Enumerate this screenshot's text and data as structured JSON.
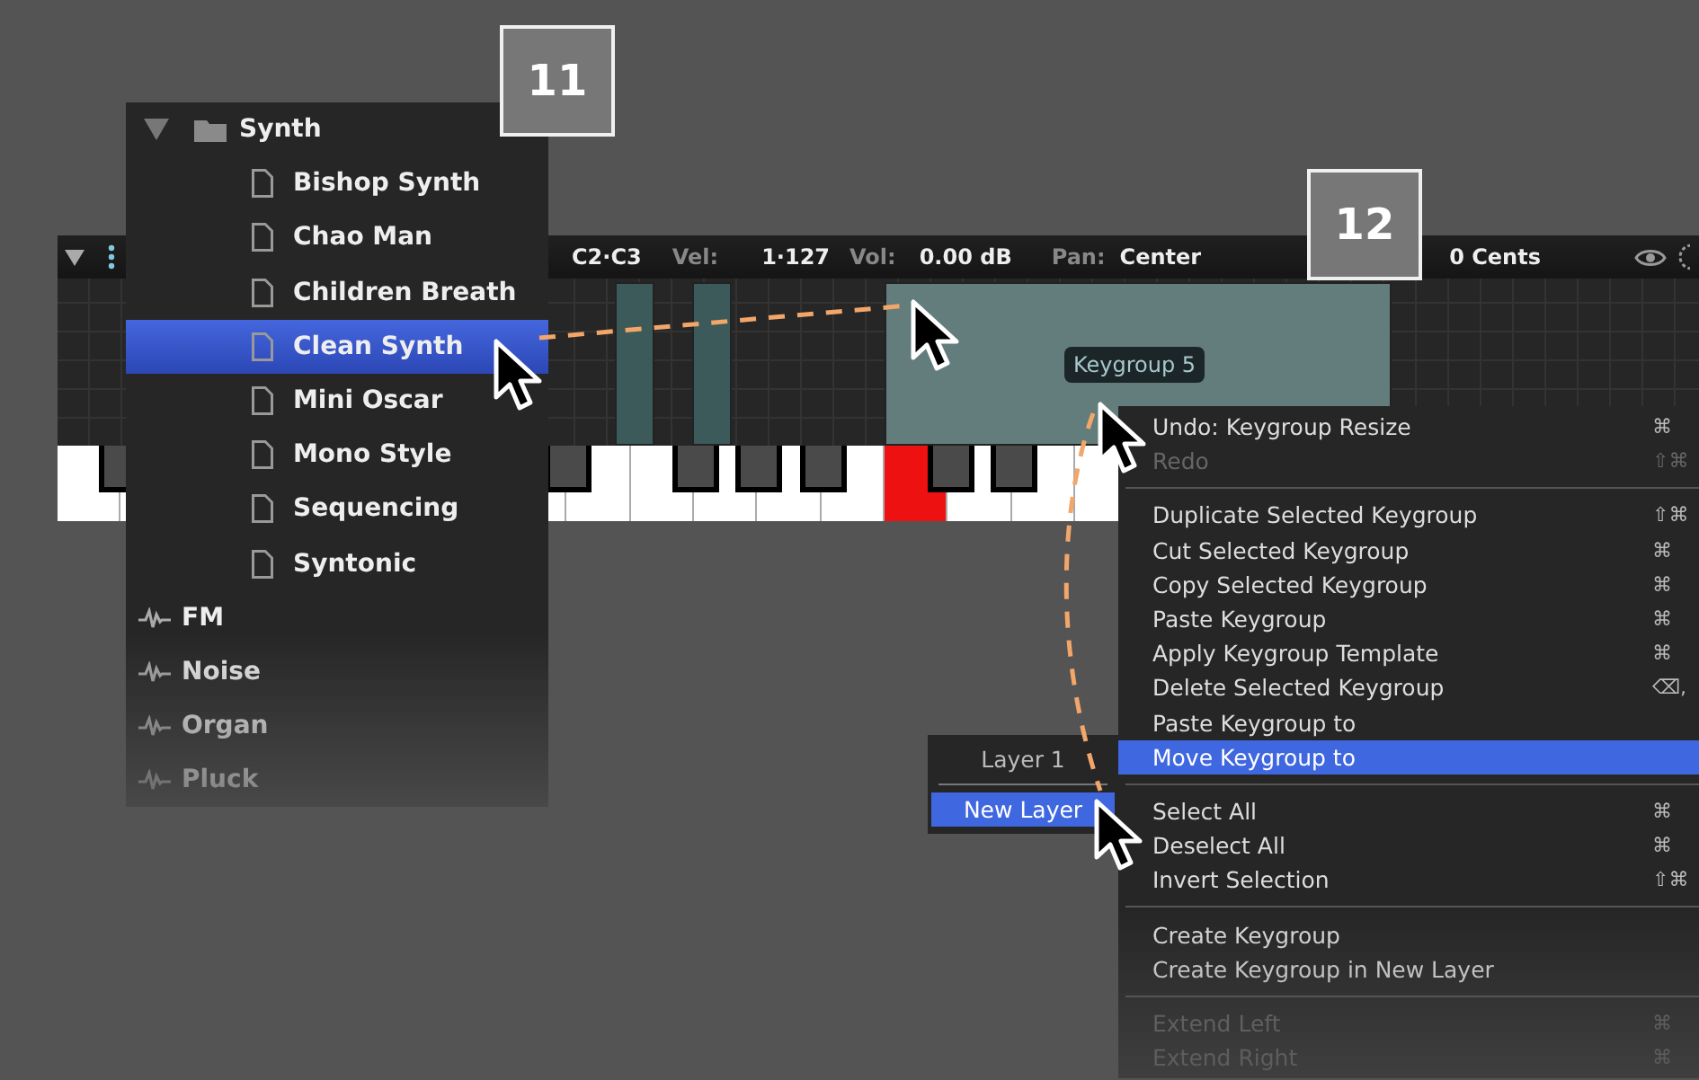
{
  "badges": [
    "11",
    "12"
  ],
  "toolbar": {
    "range": "C2·C3",
    "vel_label": "Vel:",
    "vel": "1·127",
    "vol_label": "Vol:",
    "vol": "0.00 dB",
    "pan_label": "Pan:",
    "pan": "Center",
    "tune": "0 Cents"
  },
  "tooltip": "Keygroup 5",
  "browser": {
    "items": [
      {
        "kind": "folder",
        "label": "Synth",
        "expanded": true,
        "children": [
          {
            "label": "Bishop Synth",
            "selected": false
          },
          {
            "label": "Chao Man",
            "selected": false
          },
          {
            "label": "Children Breath",
            "selected": false
          },
          {
            "label": "Clean Synth",
            "selected": true
          },
          {
            "label": "Mini Oscar",
            "selected": false
          },
          {
            "label": "Mono Style",
            "selected": false
          },
          {
            "label": "Sequencing",
            "selected": false
          },
          {
            "label": "Syntonic",
            "selected": false
          }
        ]
      },
      {
        "kind": "category",
        "label": "FM"
      },
      {
        "kind": "category",
        "label": "Noise"
      },
      {
        "kind": "category",
        "label": "Organ"
      },
      {
        "kind": "category",
        "label": "Pluck"
      }
    ]
  },
  "context_menu": {
    "items": [
      {
        "kind": "item",
        "label": "Undo: Keygroup Resize",
        "shortcut": "⌘",
        "disabled": false,
        "selected": false
      },
      {
        "kind": "item",
        "label": "Redo",
        "shortcut": "⇧⌘",
        "disabled": true,
        "selected": false
      },
      {
        "kind": "separator"
      },
      {
        "kind": "item",
        "label": "Duplicate Selected Keygroup",
        "shortcut": "⇧⌘",
        "disabled": false,
        "selected": false
      },
      {
        "kind": "item",
        "label": "Cut Selected Keygroup",
        "shortcut": "⌘",
        "disabled": false,
        "selected": false
      },
      {
        "kind": "item",
        "label": "Copy Selected Keygroup",
        "shortcut": "⌘",
        "disabled": false,
        "selected": false
      },
      {
        "kind": "item",
        "label": "Paste Keygroup",
        "shortcut": "⌘",
        "disabled": false,
        "selected": false
      },
      {
        "kind": "item",
        "label": "Apply Keygroup Template",
        "shortcut": "⌘",
        "disabled": false,
        "selected": false
      },
      {
        "kind": "item",
        "label": "Delete Selected Keygroup",
        "shortcut": "⌫,",
        "disabled": false,
        "selected": false
      },
      {
        "kind": "item",
        "label": "Paste Keygroup to",
        "disabled": false,
        "selected": false
      },
      {
        "kind": "item",
        "label": "Move Keygroup to",
        "disabled": false,
        "selected": true
      },
      {
        "kind": "separator"
      },
      {
        "kind": "item",
        "label": "Select All",
        "shortcut": "⌘",
        "disabled": false,
        "selected": false
      },
      {
        "kind": "item",
        "label": "Deselect All",
        "shortcut": "⌘",
        "disabled": false,
        "selected": false
      },
      {
        "kind": "item",
        "label": "Invert Selection",
        "shortcut": "⇧⌘",
        "disabled": false,
        "selected": false
      },
      {
        "kind": "separator"
      },
      {
        "kind": "item",
        "label": "Create Keygroup",
        "disabled": false,
        "selected": false
      },
      {
        "kind": "item",
        "label": "Create Keygroup in New Layer",
        "disabled": false,
        "selected": false
      },
      {
        "kind": "separator"
      },
      {
        "kind": "item",
        "label": "Extend Left",
        "shortcut": "⌘",
        "disabled": true,
        "selected": false
      },
      {
        "kind": "item",
        "label": "Extend Right",
        "shortcut": "⌘",
        "disabled": true,
        "selected": false
      }
    ]
  },
  "layer_menu": {
    "items": [
      {
        "label": "Layer 1",
        "selected": false
      },
      {
        "label": "New Layer",
        "selected": true
      }
    ]
  }
}
